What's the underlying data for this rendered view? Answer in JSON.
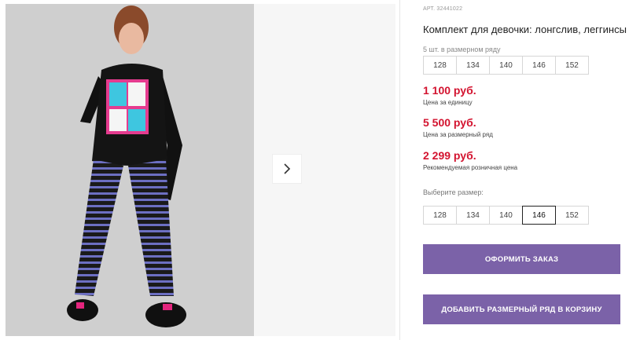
{
  "product": {
    "article": "АРТ. 32441022",
    "title": "Комплект для девочки: лонгслив, леггинсы"
  },
  "size_row": {
    "note": "5 шт. в размерном ряду",
    "sizes": [
      "128",
      "134",
      "140",
      "146",
      "152"
    ]
  },
  "prices": [
    {
      "amount": "1 100 руб.",
      "label": "Цена за единицу"
    },
    {
      "amount": "5 500 руб.",
      "label": "Цена за размерный ряд"
    },
    {
      "amount": "2 299 руб.",
      "label": "Рекомендуемая розничная цена"
    }
  ],
  "size_picker": {
    "label": "Выберите размер:",
    "sizes": [
      "128",
      "134",
      "140",
      "146",
      "152"
    ],
    "selected": "146"
  },
  "buttons": {
    "order": "ОФОРМИТЬ ЗАКАЗ",
    "add_row": "ДОБАВИТЬ РАЗМЕРНЫЙ РЯД В КОРЗИНУ"
  },
  "colors": {
    "price": "#d3132f",
    "accent_button": "#7b62a8"
  },
  "icons": {
    "next": "chevron-right-icon"
  }
}
